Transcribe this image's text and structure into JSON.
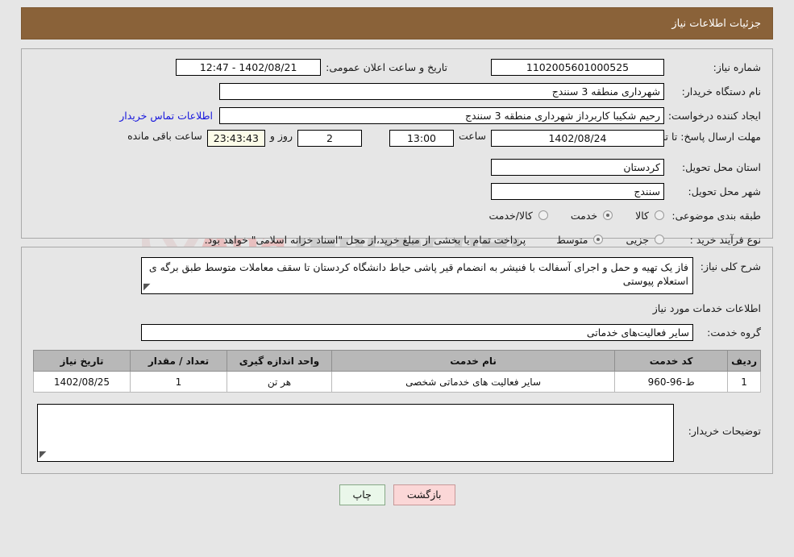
{
  "header": {
    "title": "جزئیات اطلاعات نیاز"
  },
  "fields": {
    "need_number_label": "شماره نیاز:",
    "need_number_value": "1102005601000525",
    "announce_label": "تاریخ و ساعت اعلان عمومی:",
    "announce_value": "1402/08/21 - 12:47",
    "buyer_org_label": "نام دستگاه خریدار:",
    "buyer_org_value": "شهرداری منطقه 3 سنندج",
    "creator_label": "ایجاد کننده درخواست:",
    "creator_value": "رحیم شکیبا کاربرداز شهرداری منطقه 3 سنندج",
    "contact_link": "اطلاعات تماس خریدار",
    "deadline_label": "مهلت ارسال پاسخ: تا تاریخ:",
    "deadline_date": "1402/08/24",
    "hour_label": "ساعت",
    "deadline_time": "13:00",
    "days_value": "2",
    "days_label": "روز و",
    "countdown_value": "23:43:43",
    "remaining_label": "ساعت باقی مانده",
    "province_label": "استان محل تحویل:",
    "province_value": "کردستان",
    "city_label": "شهر محل تحویل:",
    "city_value": "سنندج",
    "category_label": "طبقه بندی موضوعی:",
    "process_label": "نوع فرآیند خرید :",
    "process_note": "پرداخت تمام یا بخشی از مبلغ خرید،از محل \"اسناد خزانه اسلامی\" خواهد بود."
  },
  "category_options": [
    {
      "label": "کالا",
      "checked": false
    },
    {
      "label": "خدمت",
      "checked": true
    },
    {
      "label": "کالا/خدمت",
      "checked": false
    }
  ],
  "process_options": [
    {
      "label": "جزیی",
      "checked": false
    },
    {
      "label": "متوسط",
      "checked": true
    }
  ],
  "description": {
    "label": "شرح کلی نیاز:",
    "value": "فاز یک تهیه و حمل و اجرای آسفالت با فنیشر به انضمام قیر پاشی حیاط دانشگاه کردستان تا سقف معاملات متوسط طبق برگه ی استعلام پیوستی"
  },
  "services_section": {
    "title": "اطلاعات خدمات مورد نیاز",
    "group_label": "گروه خدمت:",
    "group_value": "سایر فعالیت‌های خدماتی"
  },
  "table": {
    "headers": [
      "ردیف",
      "کد خدمت",
      "نام خدمت",
      "واحد اندازه گیری",
      "تعداد / مقدار",
      "تاریخ نیاز"
    ],
    "rows": [
      [
        "1",
        "ط-96-960",
        "سایر فعالیت های خدماتی شخصی",
        "هر تن",
        "1",
        "1402/08/25"
      ]
    ]
  },
  "buyer_notes": {
    "label": "توضیحات خریدار:",
    "value": ""
  },
  "footer": {
    "print_label": "چاپ",
    "back_label": "بازگشت"
  },
  "watermark": {
    "text_left": "Ana",
    "text_right": "Tender.net"
  },
  "colors": {
    "header_bg": "#8a6239",
    "page_bg": "#e6e6e6",
    "link": "#1616dd",
    "print_btn": "#eaf7ea",
    "back_btn": "#fbd7d7",
    "table_header": "#b8b8b8"
  }
}
